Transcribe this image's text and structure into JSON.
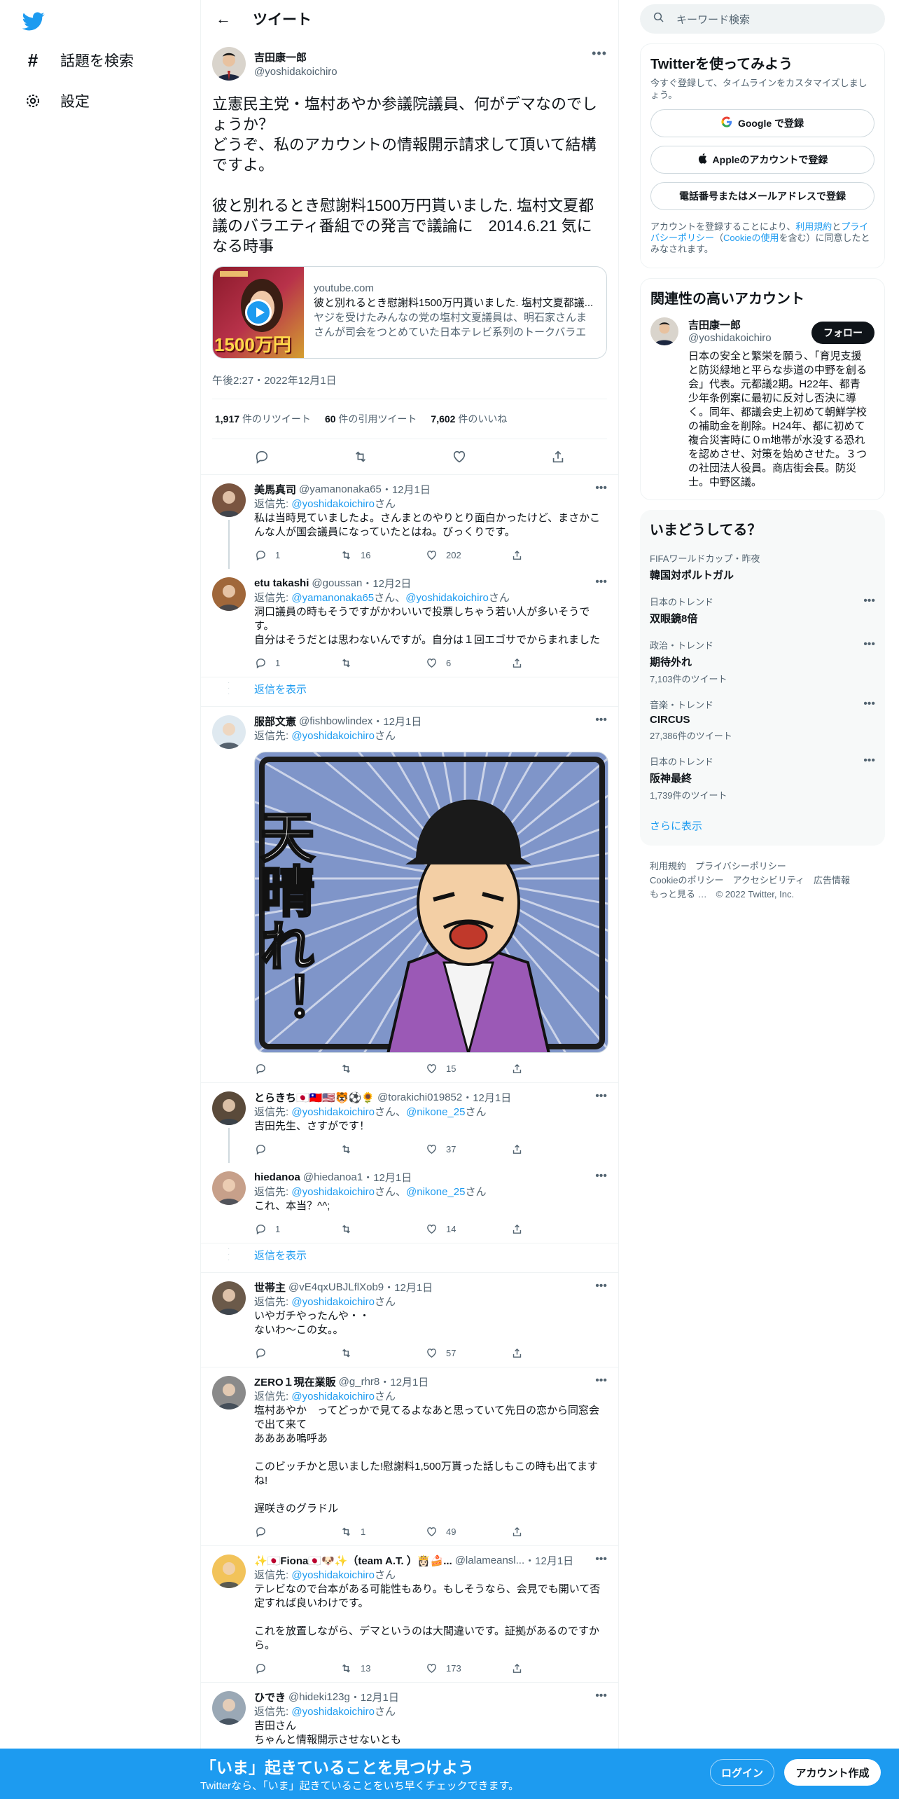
{
  "nav": {
    "explore": "話題を検索",
    "settings": "設定"
  },
  "header": {
    "title": "ツイート"
  },
  "main_tweet": {
    "name": "吉田康一郎",
    "handle": "@yoshidakoichiro",
    "text": "立憲民主党・塩村あやか参議院議員、何がデマなのでしょうか？\nどうぞ、私のアカウントの情報開示請求して頂いて結構ですよ。\n\n彼と別れるとき慰謝料1500万円貰いました. 塩村文夏都議のバラエティ番組での発言で議論に　2014.6.21 気になる時事",
    "card": {
      "domain": "youtube.com",
      "title": "彼と別れるとき慰謝料1500万円貰いました. 塩村文夏都議...",
      "desc": "ヤジを受けたみんなの党の塩村文夏議員は、明石家さんまさんが司会をつとめていた日本テレビ系列のトークバラエテ...",
      "overlay": "1500万円"
    },
    "timestamp": "午後2:27・2022年12月1日",
    "stats": {
      "retweets_num": "1,917",
      "retweets_label": "件のリツイート",
      "quotes_num": "60",
      "quotes_label": "件の引用ツイート",
      "likes_num": "7,602",
      "likes_label": "件のいいね"
    }
  },
  "labels": {
    "reply_to": "返信先:",
    "san": "さん",
    "and": "、",
    "show_replies": "返信を表示"
  },
  "replies": [
    {
      "name": "美馬真司",
      "handle": "@yamanonaka65",
      "date": "・12月1日",
      "to": [
        "@yoshidakoichiro"
      ],
      "text": "私は当時見ていましたよ。さんまとのやりとり面白かったけど、まさかこんな人が国会議員になっていたとはね。びっくりです。",
      "replies": "1",
      "retweets": "16",
      "likes": "202"
    },
    {
      "name": "etu takashi",
      "handle": "@goussan",
      "date": "・12月2日",
      "to": [
        "@yamanonaka65",
        "@yoshidakoichiro"
      ],
      "text": "洞口議員の時もそうですがかわいいで投票しちゃう若い人が多いそうです。\n自分はそうだとは思わないんですが。自分は１回エゴサでからまれました",
      "replies": "1",
      "retweets": "",
      "likes": "6"
    },
    {
      "name": "服部文憲",
      "handle": "@fishbowlindex",
      "date": "・12月1日",
      "to": [
        "@yoshidakoichiro"
      ],
      "text": "",
      "image_text": "天晴れ！",
      "replies": "",
      "retweets": "",
      "likes": "15"
    },
    {
      "name": "とらきち🇯🇵🇹🇼🇺🇸🐯⚽🌻",
      "handle": "@torakichi019852",
      "date": "・12月1日",
      "to": [
        "@yoshidakoichiro",
        "@nikone_25"
      ],
      "text": "吉田先生、さすがです！",
      "replies": "",
      "retweets": "",
      "likes": "37"
    },
    {
      "name": "hiedanoa",
      "handle": "@hiedanoa1",
      "date": "・12月1日",
      "to": [
        "@yoshidakoichiro",
        "@nikone_25"
      ],
      "text": "これ、本当？^^;",
      "replies": "1",
      "retweets": "",
      "likes": "14"
    },
    {
      "name": "世帯主",
      "handle": "@vE4qxUBJLflXob9",
      "date": "・12月1日",
      "to": [
        "@yoshidakoichiro"
      ],
      "text": "いやガチやったんや・・\nないわ～この女。。",
      "replies": "",
      "retweets": "",
      "likes": "57"
    },
    {
      "name": "ZERO１現在業販",
      "handle": "@g_rhr8",
      "date": "・12月1日",
      "to": [
        "@yoshidakoichiro"
      ],
      "text": "塩村あやか　ってどっかで見てるよなあと思っていて先日の恋から同窓会で出て来て\nああああ嗚呼あ\n\nこのビッチかと思いました!慰謝料1,500万貰った話しもこの時も出てますね!\n\n遅咲きのグラドル",
      "replies": "",
      "retweets": "1",
      "likes": "49"
    },
    {
      "name": "✨🇯🇵Fiona🇯🇵🐶✨（team A.T. ）👸🏻🍰...",
      "handle": "@lalameansl...",
      "date": "・12月1日",
      "to": [
        "@yoshidakoichiro"
      ],
      "text": "テレビなので台本がある可能性もあり。もしそうなら、会見でも開いて否定すれば良いわけです。\n\nこれを放置しながら、デマというのは大間違いです。証拠があるのですから。",
      "replies": "",
      "retweets": "13",
      "likes": "173"
    },
    {
      "name": "ひでき",
      "handle": "@hideki123g",
      "date": "・12月1日",
      "to": [
        "@yoshidakoichiro"
      ],
      "text": "吉田さん\nちゃんと情報開示させないとも"
    }
  ],
  "right": {
    "search_placeholder": "キーワード検索",
    "signup": {
      "title": "Twitterを使ってみよう",
      "sub": "今すぐ登録して、タイムラインをカスタマイズしましょう。",
      "google": "Google で登録",
      "apple": "Appleのアカウントで登録",
      "phone": "電話番号またはメールアドレスで登録",
      "legal_1": "アカウントを登録することにより、",
      "legal_terms": "利用規約",
      "legal_2": "と",
      "legal_privacy": "プライバシーポリシー",
      "legal_3": "（",
      "legal_cookie": "Cookieの使用",
      "legal_4": "を含む）に同意したとみなされます。"
    },
    "related": {
      "title": "関連性の高いアカウント",
      "name": "吉田康一郎",
      "handle": "@yoshidakoichiro",
      "follow": "フォロー",
      "bio": "日本の安全と繁栄を願う、「育児支援と防災緑地と平らな歩道の中野を創る会」代表。元都議2期。H22年、都青少年条例案に最初に反対し否決に導く。同年、都議会史上初めて朝鮮学校の補助金を削除。H24年、都に初めて複合災害時に０m地帯が水没する恐れを認めさせ、対策を始めさせた。３つの社団法人役員。商店街会長。防災士。中野区議。"
    },
    "trends": {
      "title": "いまどうしてる？",
      "items": [
        {
          "ctx": "FIFAワールドカップ・昨夜",
          "name": "韓国対ポルトガル",
          "count": ""
        },
        {
          "ctx": "日本のトレンド",
          "name": "双眼鏡8倍",
          "count": ""
        },
        {
          "ctx": "政治・トレンド",
          "name": "期待外れ",
          "count": "7,103件のツイート"
        },
        {
          "ctx": "音楽・トレンド",
          "name": "CIRCUS",
          "count": "27,386件のツイート"
        },
        {
          "ctx": "日本のトレンド",
          "name": "阪神最終",
          "count": "1,739件のツイート"
        }
      ],
      "show_more": "さらに表示"
    },
    "footer": {
      "l1": "利用規約　プライバシーポリシー",
      "l2": "Cookieのポリシー　アクセシビリティ　広告情報",
      "l3": "もっと見る …　© 2022 Twitter, Inc."
    }
  },
  "banner": {
    "title": "「いま」起きていることを見つけよう",
    "sub": "Twitterなら、「いま」起きていることをいち早くチェックできます。",
    "login": "ログイン",
    "signup": "アカウント作成"
  },
  "colors": {
    "brand": "#1d9bf0",
    "text": "#0f1419",
    "secondary": "#536471"
  }
}
